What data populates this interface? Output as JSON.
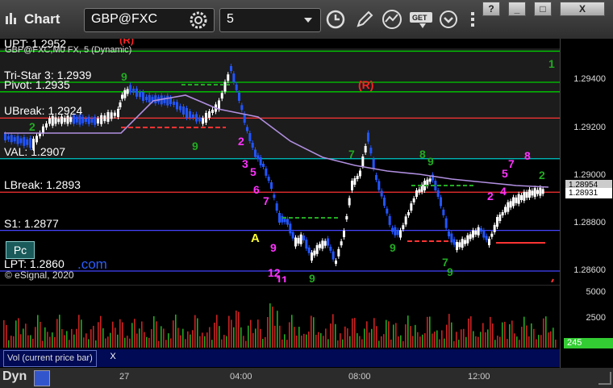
{
  "window": {
    "title": "Chart",
    "symbol": "GBP@FXC",
    "interval": "5",
    "buttons": {
      "help": "?",
      "minimize": "_",
      "maximize": "□",
      "close": "X"
    }
  },
  "study": {
    "title": "GBP@FXC,M0 FX, 5 (Dynamic)",
    "copyright": "© eSignal, 2020",
    "pc_label": "Pc",
    "com_fragment": ".com"
  },
  "levels": [
    {
      "label": "UPT: 1.2952",
      "value": 1.2952,
      "color": "#00cc00"
    },
    {
      "label": "Tri-Star 3: 1.2939",
      "value": 1.2939,
      "color": "#00cc00"
    },
    {
      "label": "Pivot: 1.2935",
      "value": 1.2935,
      "color": "#00cc00"
    },
    {
      "label": "UBreak: 1.2924",
      "value": 1.2924,
      "color": "#ff3333"
    },
    {
      "label": "VAL: 1.2907",
      "value": 1.2907,
      "color": "#00cccc"
    },
    {
      "label": "LBreak: 1.2893",
      "value": 1.2893,
      "color": "#ff3333"
    },
    {
      "label": "S1: 1.2877",
      "value": 1.2877,
      "color": "#4444ff"
    },
    {
      "label": "LPT: 1.2860",
      "value": 1.286,
      "color": "#4444ff"
    }
  ],
  "price_axis": {
    "ticks": [
      "1.29400",
      "1.29200",
      "1.29000",
      "1.28800",
      "1.28600"
    ],
    "tags": [
      {
        "text": "1.28954",
        "color": "#cccccc"
      },
      {
        "text": "1.28931",
        "color": "#ffffff"
      }
    ]
  },
  "volume": {
    "tab_label": "Vol (current price bar)",
    "close_label": "X",
    "ticks": [
      "5000",
      "2500"
    ],
    "current": "245",
    "current_color": "#33cc33"
  },
  "time_axis": {
    "labels": [
      "27",
      "04:00",
      "08:00",
      "12:00"
    ],
    "dyn_label": "Dyn"
  },
  "markers": {
    "r1": "(R)",
    "r2": "(R)",
    "a": "A"
  },
  "colors": {
    "up_candle": "#ffffff",
    "down_candle": "#2255ff",
    "ma": "#b08fe0",
    "magenta": "#ff33ff",
    "green_num": "#22aa22"
  }
}
